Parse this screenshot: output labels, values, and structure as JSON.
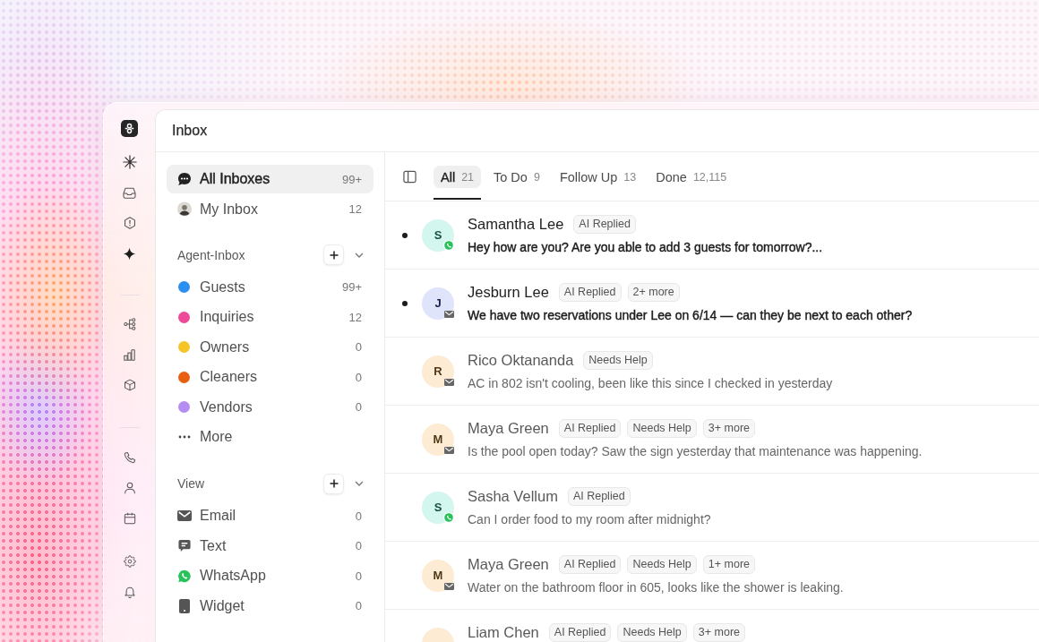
{
  "header": {
    "title": "Inbox"
  },
  "sidebar": {
    "main_items": [
      {
        "label": "All Inboxes",
        "count": "99+",
        "kind": "chat",
        "selected": true
      },
      {
        "label": "My Inbox",
        "count": "12",
        "kind": "avatar",
        "selected": false
      }
    ],
    "agent_inbox": {
      "title": "Agent-Inbox",
      "items": [
        {
          "label": "Guests",
          "count": "99+",
          "color": "#2b8ff2",
          "selected": false
        },
        {
          "label": "Inquiries",
          "count": "12",
          "color": "#ee4a9a",
          "selected": false
        },
        {
          "label": "Owners",
          "count": "0",
          "color": "#f5c426",
          "selected": false
        },
        {
          "label": "Cleaners",
          "count": "0",
          "color": "#e8600f",
          "selected": false
        },
        {
          "label": "Vendors",
          "count": "0",
          "color": "#b58cf0",
          "selected": false
        }
      ],
      "more": "More"
    },
    "view": {
      "title": "View",
      "items": [
        {
          "label": "Email",
          "count": "0",
          "kind": "email",
          "selected": false
        },
        {
          "label": "Text",
          "count": "0",
          "kind": "text",
          "selected": false
        },
        {
          "label": "WhatsApp",
          "count": "0",
          "kind": "whatsapp",
          "selected": false
        },
        {
          "label": "Widget",
          "count": "0",
          "kind": "widget",
          "selected": false
        }
      ]
    }
  },
  "tabs": [
    {
      "label": "All",
      "count": "21",
      "selected": true
    },
    {
      "label": "To Do",
      "count": "9",
      "selected": false
    },
    {
      "label": "Follow Up",
      "count": "13",
      "selected": false
    },
    {
      "label": "Done",
      "count": "12,115",
      "selected": false
    }
  ],
  "conversations": [
    {
      "name": "Samantha Lee",
      "initial": "S",
      "color": "#d3f7ee",
      "kind": "whatsapp",
      "unread": true,
      "tags": [
        "AI Replied"
      ],
      "message": "Hey how are you? Are you able to add 3 guests for tomorrow?..."
    },
    {
      "name": "Jesburn Lee",
      "initial": "J",
      "color": "#e0e4fb",
      "kind": "email",
      "unread": true,
      "tags": [
        "AI Replied",
        "2+ more"
      ],
      "message": "We have two reservations under Lee on 6/14 — can they be next to each other?"
    },
    {
      "name": "Rico Oktananda",
      "initial": "R",
      "color": "#fdebd3",
      "kind": "email",
      "unread": false,
      "tags": [
        "Needs Help"
      ],
      "message": "AC in 802 isn't cooling, been like this since I checked in yesterday"
    },
    {
      "name": "Maya Green",
      "initial": "M",
      "color": "#fdebd3",
      "kind": "email",
      "unread": false,
      "tags": [
        "AI Replied",
        "Needs Help",
        "3+ more"
      ],
      "message": "Is the pool open today? Saw the sign yesterday that maintenance was happening."
    },
    {
      "name": "Sasha Vellum",
      "initial": "S",
      "color": "#d3f7ee",
      "kind": "whatsapp",
      "unread": false,
      "tags": [
        "AI Replied"
      ],
      "message": "Can I order food to my room after midnight?"
    },
    {
      "name": "Maya Green",
      "initial": "M",
      "color": "#fdebd3",
      "kind": "email",
      "unread": false,
      "tags": [
        "AI Replied",
        "Needs Help",
        "1+ more"
      ],
      "message": "Water on the bathroom floor in 605, looks like the shower is leaking."
    },
    {
      "name": "Liam Chen",
      "color": "#fdebd3",
      "unread": false,
      "tags": [
        "AI Replied",
        "Needs Help",
        "3+ more"
      ]
    }
  ]
}
